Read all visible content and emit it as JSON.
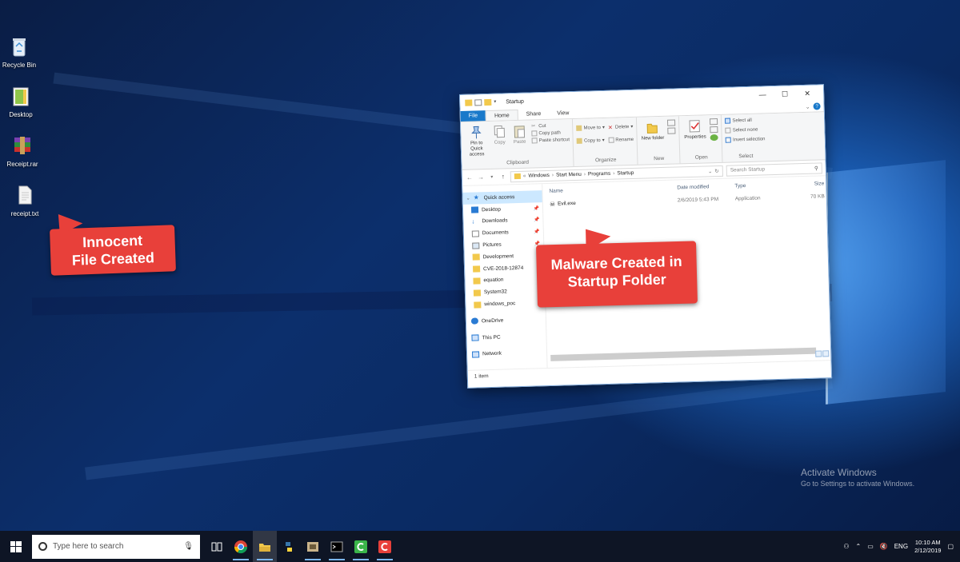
{
  "desktop": {
    "icons": [
      {
        "label": "Recycle Bin",
        "icon": "recycle-bin-icon"
      },
      {
        "label": "Desktop",
        "icon": "folder-icon"
      },
      {
        "label": "Receipt.rar",
        "icon": "winrar-archive-icon"
      },
      {
        "label": "receipt.txt",
        "icon": "text-file-icon"
      }
    ],
    "callouts": {
      "innocent": "Innocent File Created",
      "malware": "Malware Created in Startup Folder"
    },
    "watermark": {
      "title": "Activate Windows",
      "subtitle": "Go to Settings to activate Windows."
    }
  },
  "explorer": {
    "title": "Startup",
    "tabs": [
      "File",
      "Home",
      "Share",
      "View"
    ],
    "ribbon": {
      "clipboard": {
        "label": "Clipboard",
        "pin": "Pin to Quick access",
        "copy": "Copy",
        "paste": "Paste",
        "cut": "Cut",
        "copy_path": "Copy path",
        "paste_shortcut": "Paste shortcut"
      },
      "organize": {
        "label": "Organize",
        "move_to": "Move to",
        "copy_to": "Copy to",
        "delete": "Delete",
        "rename": "Rename"
      },
      "new": {
        "label": "New",
        "new_folder": "New folder"
      },
      "open": {
        "label": "Open",
        "properties": "Properties"
      },
      "select": {
        "label": "Select",
        "select_all": "Select all",
        "select_none": "Select none",
        "invert": "Invert selection"
      }
    },
    "address": {
      "path": [
        "Windows",
        "Start Menu",
        "Programs",
        "Startup"
      ],
      "search_placeholder": "Search Startup"
    },
    "nav": {
      "quick_access": "Quick access",
      "items": [
        {
          "label": "Desktop",
          "pinned": true
        },
        {
          "label": "Downloads",
          "pinned": true
        },
        {
          "label": "Documents",
          "pinned": true
        },
        {
          "label": "Pictures",
          "pinned": true
        },
        {
          "label": "Development",
          "pinned": false
        },
        {
          "label": "CVE-2018-12874",
          "pinned": false
        },
        {
          "label": "equation",
          "pinned": false
        },
        {
          "label": "System32",
          "pinned": false
        },
        {
          "label": "windows_poc",
          "pinned": false
        }
      ],
      "onedrive": "OneDrive",
      "this_pc": "This PC",
      "network": "Network"
    },
    "columns": {
      "name": "Name",
      "date": "Date modified",
      "type": "Type",
      "size": "Size"
    },
    "files": [
      {
        "name": "Evil.exe",
        "date": "2/6/2019 5:43 PM",
        "type": "Application",
        "size": "70 KB"
      }
    ],
    "status": "1 item"
  },
  "taskbar": {
    "search_placeholder": "Type here to search",
    "apps": [
      "task-view-icon",
      "chrome-icon",
      "file-explorer-icon",
      "python-icon",
      "app-icon",
      "terminal-icon",
      "green-c-app-icon",
      "red-c-app-icon"
    ],
    "tray": {
      "language": "ENG",
      "time": "10:10 AM",
      "date": "2/12/2019"
    }
  },
  "colors": {
    "callout": "#e8403a",
    "file_tab": "#1979ca",
    "taskbar": "#0e1525"
  }
}
